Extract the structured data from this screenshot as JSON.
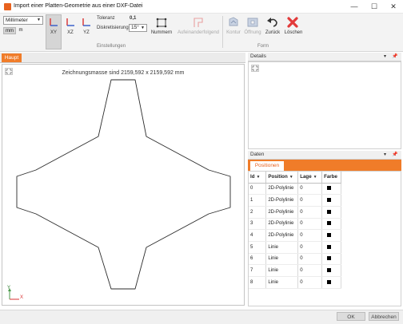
{
  "window": {
    "title": "Import einer Platten-Geometrie aus einer DXF-Datei",
    "accent": "#f07c29",
    "controls": {
      "minimize": "—",
      "maximize": "☐",
      "close": "✕"
    }
  },
  "ribbon": {
    "unit_select": "Millimeter",
    "units": [
      "mm",
      "m"
    ],
    "views": [
      "XY",
      "XZ",
      "YZ"
    ],
    "toleranz_label": "Toleranz",
    "toleranz_value": "0,1",
    "diskretisierung_label": "Diskretisierung",
    "diskretisierung_value": "15°",
    "nummern_label": "Nummern",
    "aufeinanderfolgend_label": "Aufeinanderfolgend",
    "einstellungen_group": "Einstellungen",
    "kontur_label": "Kontur",
    "oeffnung_label": "Öffnung",
    "zurueck_label": "Zurück",
    "loeschen_label": "Löschen",
    "form_group": "Form"
  },
  "main": {
    "tab": "Haupt",
    "dimensions_text": "Zeichnungsmasse sind 2159,592 x 2159,592 mm",
    "axis_y": "Y",
    "axis_x": "X"
  },
  "details": {
    "title": "Details"
  },
  "daten": {
    "title": "Daten",
    "tab": "Positionen",
    "columns": [
      "Id",
      "Position",
      "Lage",
      "Farbe"
    ],
    "rows": [
      {
        "id": "0",
        "position": "2D-Polylinie",
        "lage": "0"
      },
      {
        "id": "1",
        "position": "2D-Polylinie",
        "lage": "0"
      },
      {
        "id": "2",
        "position": "2D-Polylinie",
        "lage": "0"
      },
      {
        "id": "3",
        "position": "2D-Polylinie",
        "lage": "0"
      },
      {
        "id": "4",
        "position": "2D-Polylinie",
        "lage": "0"
      },
      {
        "id": "5",
        "position": "Linie",
        "lage": "0"
      },
      {
        "id": "6",
        "position": "Linie",
        "lage": "0"
      },
      {
        "id": "7",
        "position": "Linie",
        "lage": "0"
      },
      {
        "id": "8",
        "position": "Linie",
        "lage": "0"
      }
    ]
  },
  "footer": {
    "ok": "OK",
    "cancel": "Abbrechen"
  }
}
